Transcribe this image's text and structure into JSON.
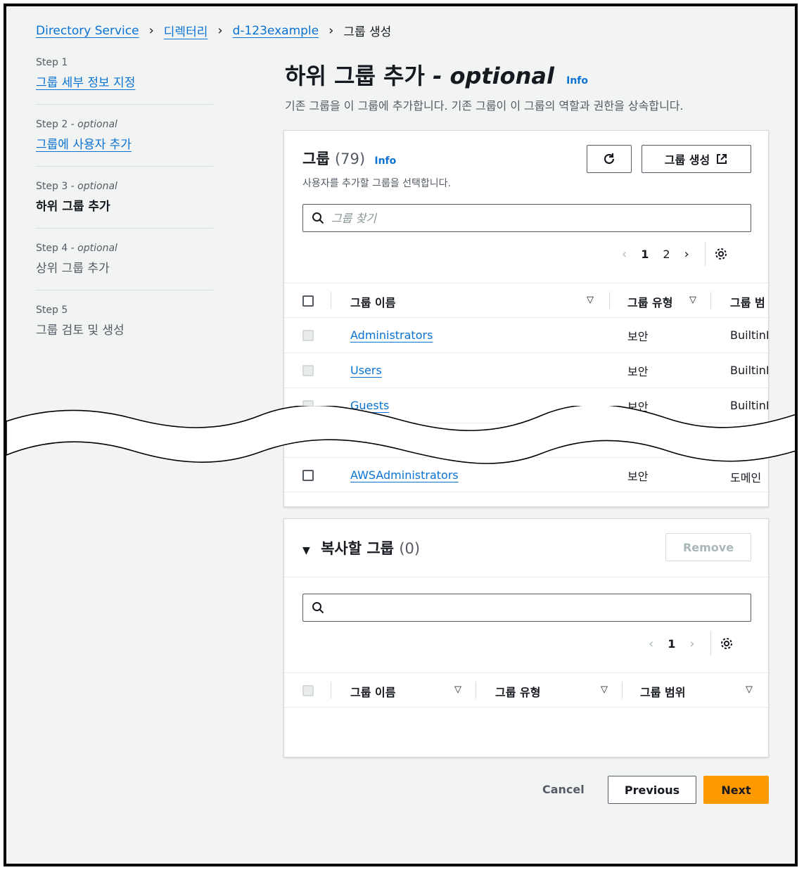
{
  "breadcrumb": {
    "items": [
      "Directory Service",
      "디렉터리",
      "d-123example"
    ],
    "current": "그룹 생성"
  },
  "steps": [
    {
      "label": "Step 1",
      "optional": "",
      "title": "그룹 세부 정보 지정"
    },
    {
      "label": "Step 2",
      "optional": " - optional",
      "title": "그룹에 사용자 추가"
    },
    {
      "label": "Step 3",
      "optional": " - optional",
      "title": "하위 그룹 추가"
    },
    {
      "label": "Step 4",
      "optional": " - optional",
      "title": "상위 그룹 추가"
    },
    {
      "label": "Step 5",
      "optional": "",
      "title": "그룹 검토 및 생성"
    }
  ],
  "page": {
    "title": "하위 그룹 추가",
    "title_suffix": "- optional",
    "info": "Info",
    "subtitle": "기존 그룹을 이 그룹에 추가합니다. 기존 그룹이 이 그룹의 역할과 권한을 상속합니다."
  },
  "groups": {
    "title": "그룹",
    "count": "(79)",
    "info": "Info",
    "description": "사용자를 추가할 그룹을 선택합니다.",
    "create_button": "그룹 생성",
    "search_placeholder": "그룹 찾기",
    "pages": [
      "1",
      "2"
    ],
    "columns": [
      "그룹 이름",
      "그룹 유형",
      "그룹 범"
    ],
    "rows": [
      {
        "name": "Administrators",
        "type": "보안",
        "scope": "BuiltinI"
      },
      {
        "name": "Users",
        "type": "보안",
        "scope": "BuiltinI"
      },
      {
        "name": "Guests",
        "type": "보안",
        "scope": "BuiltinI"
      },
      {
        "name": "AWSAdministrators",
        "type": "보안",
        "scope": "도메인"
      }
    ]
  },
  "copy_groups": {
    "title": "복사할 그룹",
    "count": "(0)",
    "remove_button": "Remove",
    "search_placeholder": "",
    "pages": [
      "1"
    ],
    "columns": [
      "그룹 이름",
      "그룹 유형",
      "그룹 범위"
    ]
  },
  "footer": {
    "cancel": "Cancel",
    "previous": "Previous",
    "next": "Next"
  },
  "colors": {
    "link": "#0972d3",
    "primary": "#ff9900",
    "background": "#f2f3f3"
  }
}
